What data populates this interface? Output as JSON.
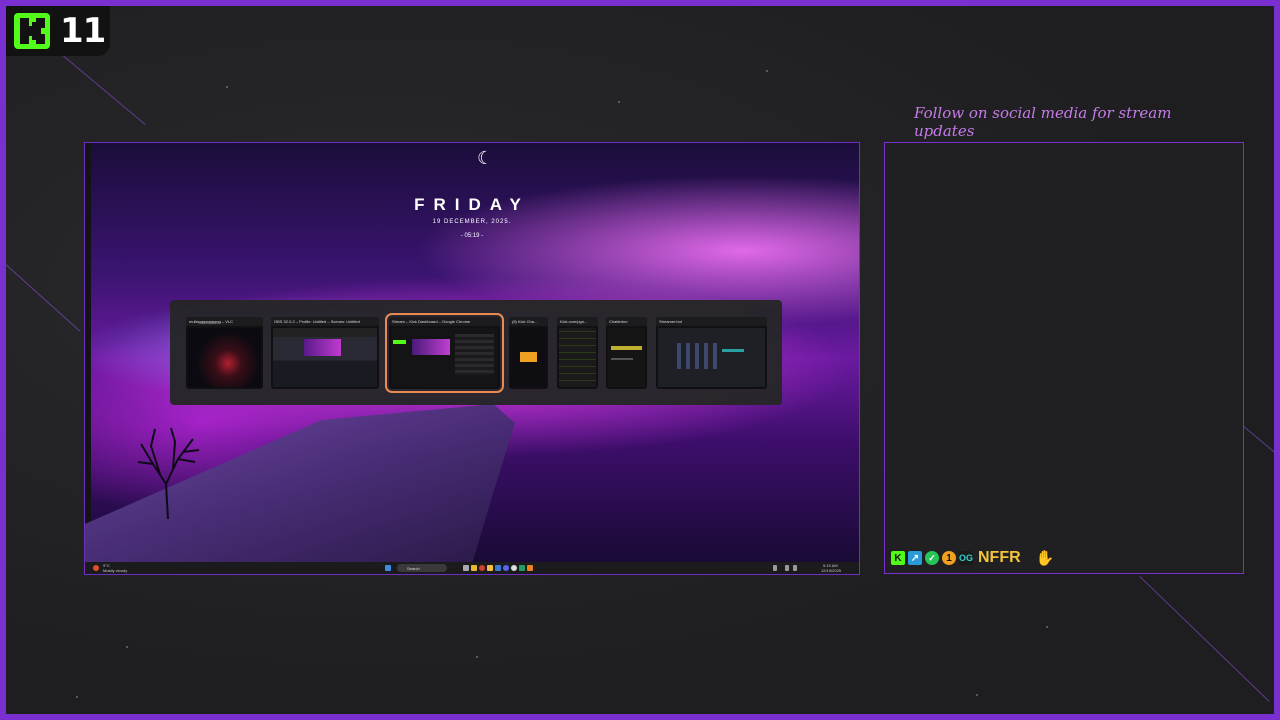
{
  "badge": {
    "logo": "kick-logo-icon",
    "number": "11"
  },
  "social_text": "Follow on social media for stream updates",
  "screen": {
    "day": "FRIDAY",
    "date": "19 DECEMBER, 2025.",
    "time": "- 05:19 -",
    "switcher": {
      "windows": [
        {
          "title": "mullagggggggggg – VLC"
        },
        {
          "title": "OBS 32.0.2 – Profile: Untitled – Scenes: Untitled"
        },
        {
          "title": "Stream – Kick Dashboard – Google Chrome"
        },
        {
          "title": "(8) Kick Cha..."
        },
        {
          "title": "Kick.com/pgn..."
        },
        {
          "title": "Chatterino"
        },
        {
          "title": "Streamer.bot"
        }
      ]
    },
    "taskbar": {
      "search_label": "Search",
      "clock_time": "5:19 AM",
      "clock_date": "12/19/2025",
      "weather": "9°C",
      "weather_label": "Mostly cloudy"
    }
  },
  "chat": {
    "username": "NFFR",
    "badges": [
      "kick-icon",
      "pin-icon",
      "verified-icon",
      "gold-coin-icon",
      "og-badge-icon"
    ],
    "message_emote": "wave-emote"
  },
  "colors": {
    "accent": "#7a2fd0",
    "kick_green": "#53fc18",
    "social_text": "#c57be8",
    "username": "#f3c43c",
    "switcher_highlight": "#e88a52"
  }
}
